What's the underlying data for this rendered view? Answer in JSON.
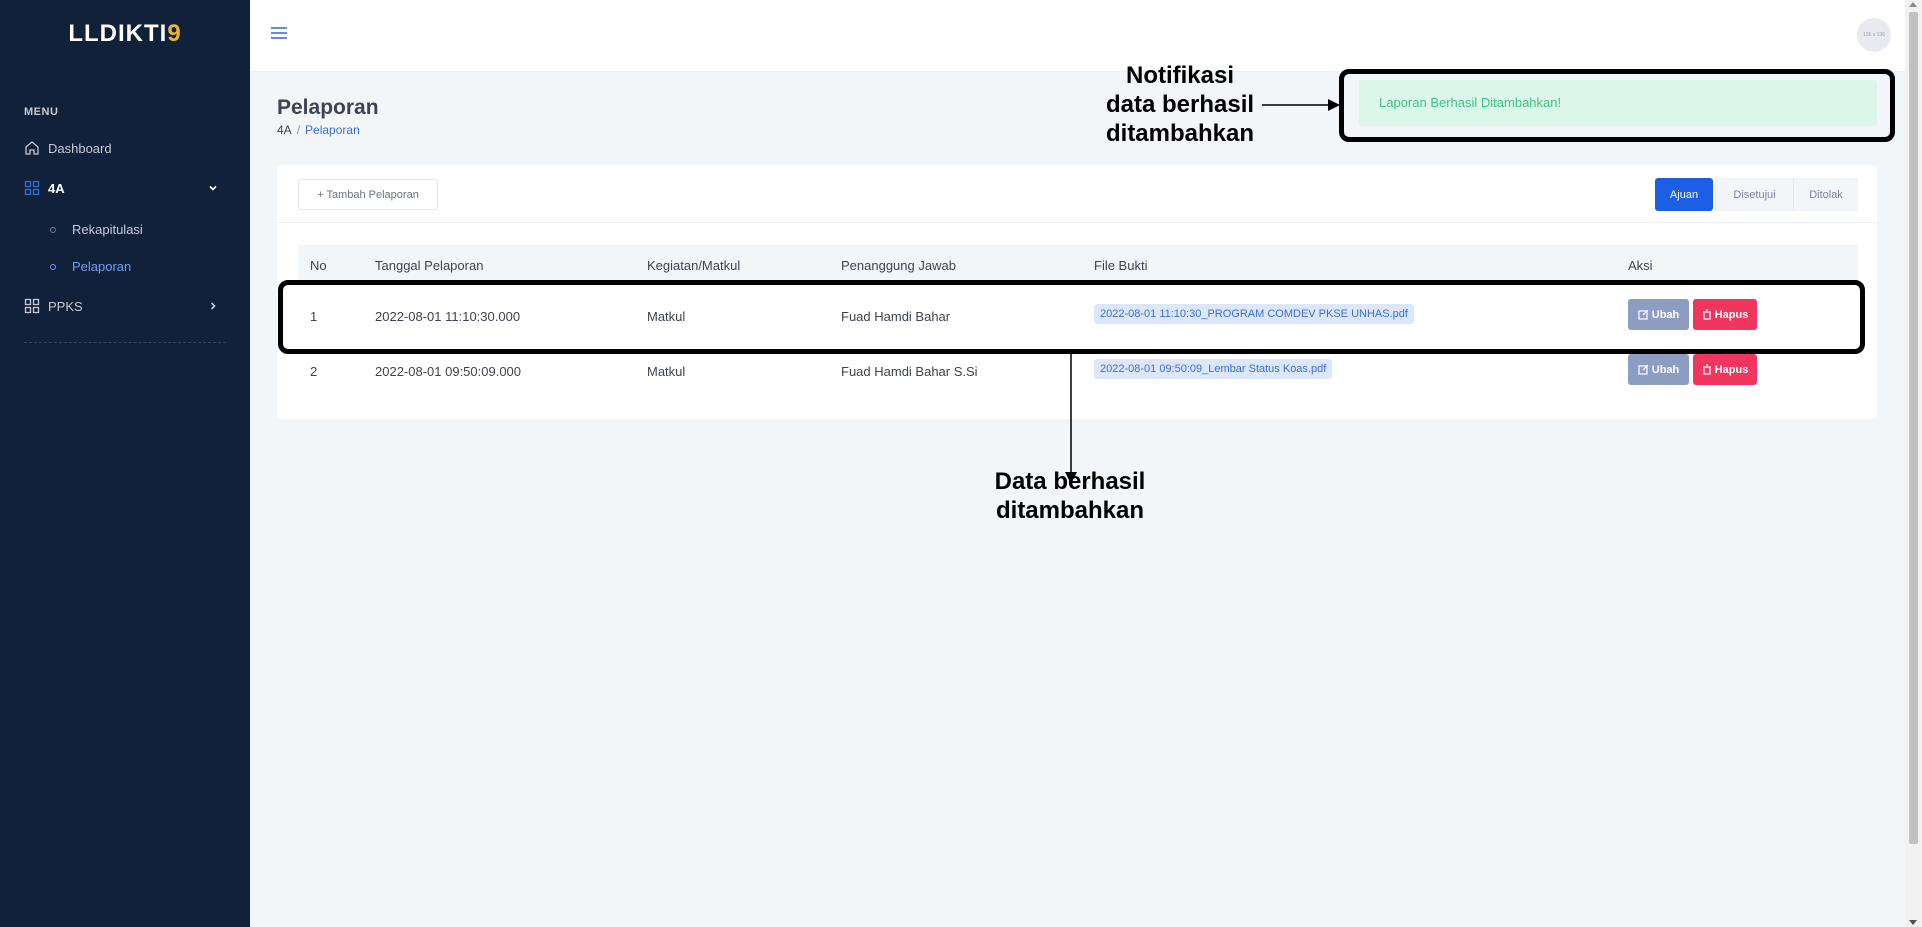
{
  "sidebar": {
    "logo_main": "LLDIKTI",
    "logo_digit": "9",
    "menu_heading": "MENU",
    "items": [
      {
        "label": "Dashboard",
        "icon": "home-icon"
      },
      {
        "label": "4A",
        "icon": "grid-icon",
        "expanded": true,
        "children": [
          {
            "label": "Rekapitulasi"
          },
          {
            "label": "Pelaporan",
            "active": true
          }
        ]
      },
      {
        "label": "PPKS",
        "icon": "grid-icon",
        "expanded": false
      }
    ]
  },
  "header": {
    "avatar_text": "136 x 136"
  },
  "page": {
    "title": "Pelaporan",
    "breadcrumb": [
      "4A",
      "Pelaporan"
    ]
  },
  "alert": {
    "message": "Laporan Berhasil Ditambahkan!"
  },
  "toolbar": {
    "add_label": "+ Tambah Pelaporan",
    "tabs": [
      {
        "label": "Ajuan",
        "active": true
      },
      {
        "label": "Disetujui",
        "active": false
      },
      {
        "label": "Ditolak",
        "active": false
      }
    ]
  },
  "table": {
    "columns": [
      "No",
      "Tanggal Pelaporan",
      "Kegiatan/Matkul",
      "Penanggung Jawab",
      "File Bukti",
      "Aksi"
    ],
    "rows": [
      {
        "no": "1",
        "tanggal": "2022-08-01 11:10:30.000",
        "kegiatan": "Matkul",
        "pj": "Fuad Hamdi Bahar",
        "file": "2022-08-01 11:10:30_PROGRAM COMDEV PKSE UNHAS.pdf"
      },
      {
        "no": "2",
        "tanggal": "2022-08-01 09:50:09.000",
        "kegiatan": "Matkul",
        "pj": "Fuad Hamdi Bahar S.Si",
        "file": "2022-08-01 09:50:09_Lembar Status Koas.pdf"
      }
    ],
    "action_edit": "Ubah",
    "action_delete": "Hapus"
  },
  "annotations": {
    "notif_line1": "Notifikasi",
    "notif_line2": "data berhasil",
    "notif_line3": "ditambahkan",
    "data_line1": "Data berhasil",
    "data_line2": "ditambahkan"
  },
  "colors": {
    "sidebar_bg": "#12213a",
    "accent": "#1c5ee6",
    "success_bg": "#dcf7ea",
    "success_text": "#3cc487",
    "danger": "#f0365e",
    "edit": "#8d9cc1"
  }
}
